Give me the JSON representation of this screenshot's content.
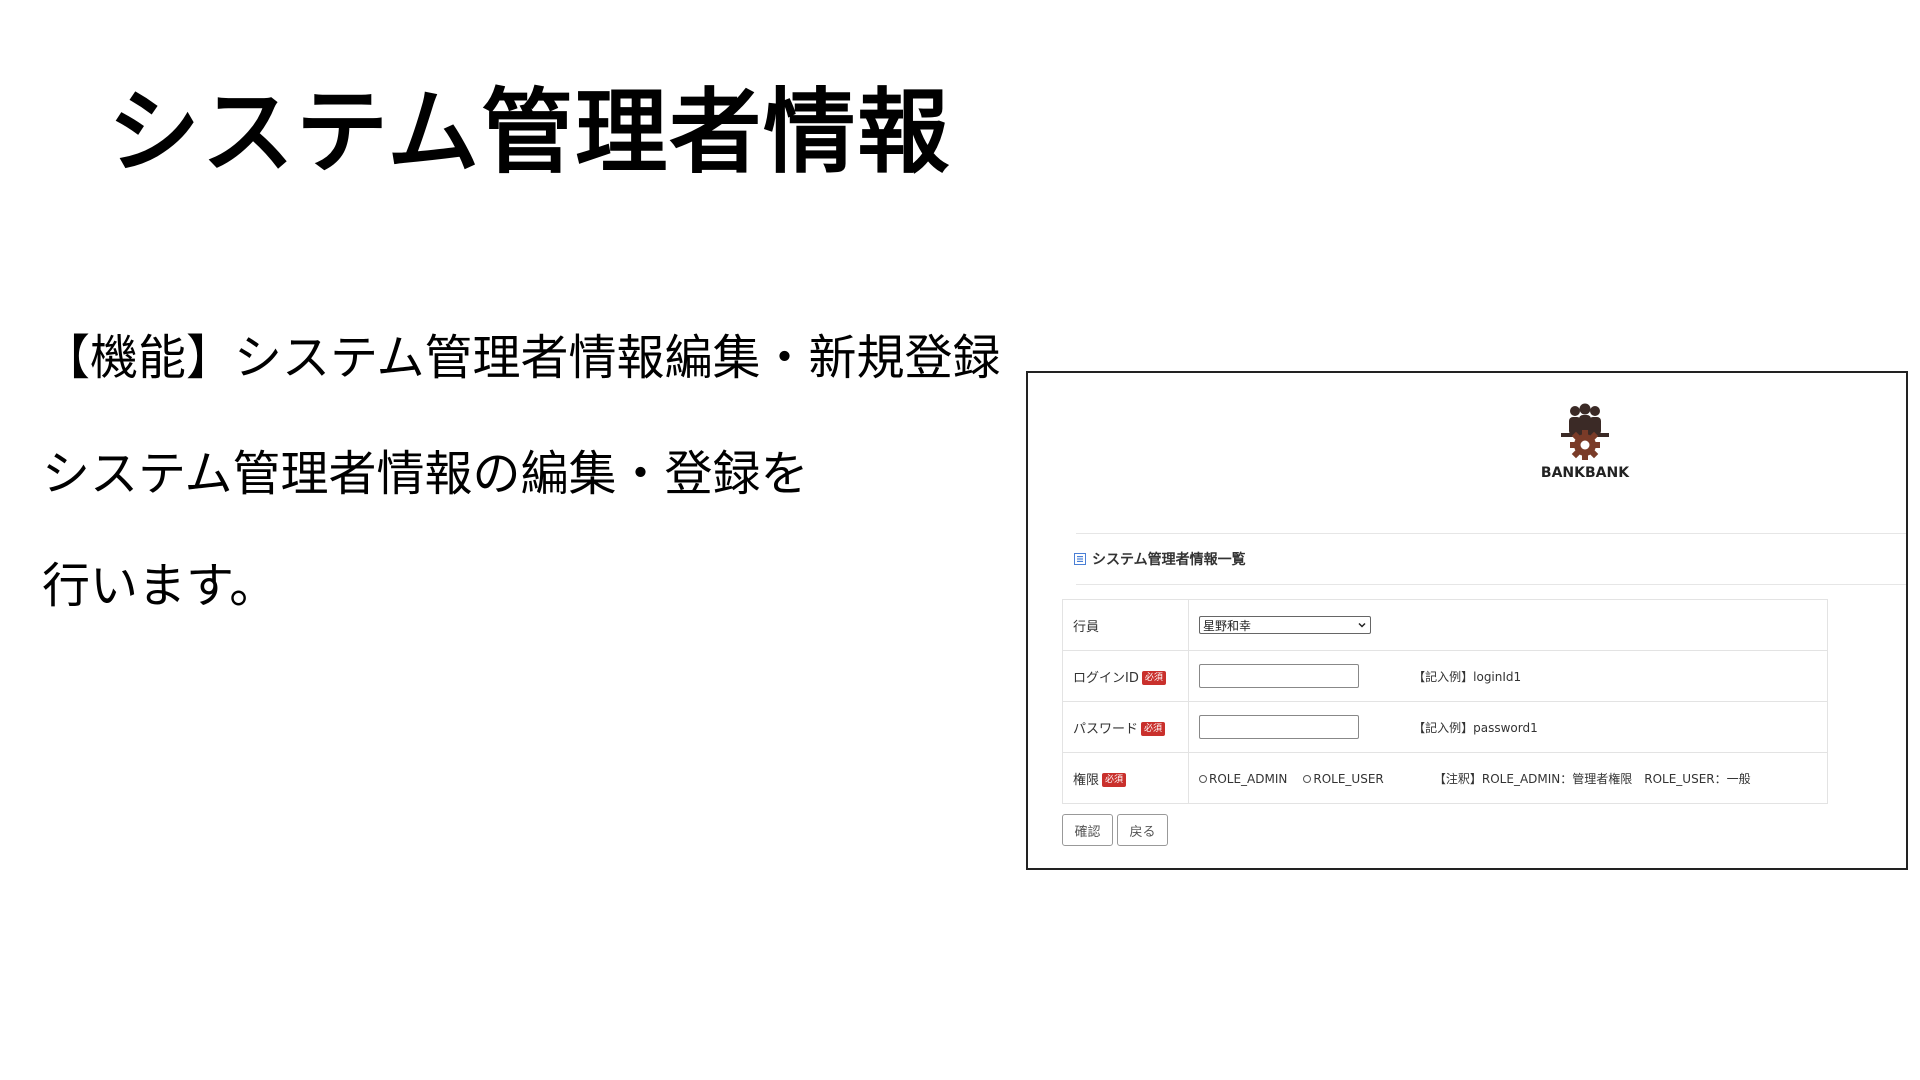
{
  "slide": {
    "title": "システム管理者情報",
    "lines": [
      "【機能】システム管理者情報編集・新規登録",
      "システム管理者情報の編集・登録を",
      "行います。"
    ]
  },
  "screenshot": {
    "logo": {
      "text": "BANKBANK",
      "icon": "people-gear-logo-icon",
      "color": "#3b2a26"
    },
    "section_title": "システム管理者情報一覧",
    "section_icon": "list-icon",
    "required_badge": "必須",
    "form": {
      "employee": {
        "label": "行員",
        "selected": "星野和幸"
      },
      "login_id": {
        "label": "ログインID",
        "value": "",
        "example": "【記入例】loginId1"
      },
      "password": {
        "label": "パスワード",
        "value": "",
        "example": "【記入例】password1"
      },
      "role": {
        "label": "権限",
        "options": [
          "ROLE_ADMIN",
          "ROLE_USER"
        ],
        "note": "【注釈】ROLE_ADMIN：管理者権限　ROLE_USER：一般"
      }
    },
    "buttons": {
      "confirm": "確認",
      "back": "戻る"
    },
    "colors": {
      "required_badge": "#c9302c",
      "list_icon": "#4a7fd6"
    }
  }
}
